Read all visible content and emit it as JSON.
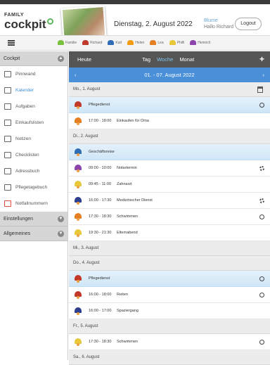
{
  "header": {
    "logo_top": "FAMILY",
    "logo_main": "cockpit",
    "date": "Dienstag, 2. August 2022",
    "user_name": "Blume",
    "user_greeting": "Hallo Richard",
    "logout": "Logout"
  },
  "family": [
    {
      "name": "Familie",
      "color": "#7bbf3f"
    },
    {
      "name": "Richard",
      "color": "#c0392b"
    },
    {
      "name": "Karl",
      "color": "#2f6db5"
    },
    {
      "name": "Helen",
      "color": "#f39c12"
    },
    {
      "name": "Lea",
      "color": "#e67e22"
    },
    {
      "name": "Philli",
      "color": "#e8c83a"
    },
    {
      "name": "Heinrich",
      "color": "#8e44ad"
    }
  ],
  "sidebar": {
    "section1": "Cockpit",
    "items": [
      {
        "label": "Pinnwand",
        "active": false
      },
      {
        "label": "Kalender",
        "active": true
      },
      {
        "label": "Aufgaben",
        "active": false
      },
      {
        "label": "Einkaufslisten",
        "active": false
      },
      {
        "label": "Notizen",
        "active": false
      },
      {
        "label": "Checklisten",
        "active": false
      },
      {
        "label": "Adressbuch",
        "active": false
      },
      {
        "label": "Pflegetagebuch",
        "active": false
      },
      {
        "label": "Notfallnummern",
        "active": false
      }
    ],
    "section2": "Einstellungen",
    "section3": "Allgemeines"
  },
  "calendar": {
    "today": "Heute",
    "tabs": [
      "Tag",
      "Woche",
      "Monat"
    ],
    "selected_tab": "Woche",
    "add": "+",
    "week_label": "01. - 07. August 2022",
    "prev": "‹",
    "next": "›",
    "days": [
      {
        "label": "Mo., 1. August",
        "birthday": true,
        "events": [
          {
            "allday": true,
            "title": "Pflegedienst",
            "color": "#c0392b",
            "indicator": "circle"
          },
          {
            "time": "17:00 - 18:00",
            "title": "Einkaufen für Oma",
            "color": "#e67e22",
            "indicator": ""
          }
        ]
      },
      {
        "label": "Di., 2. August",
        "birthday": false,
        "events": [
          {
            "allday": true,
            "title": "Geschäftsreise",
            "color": "#2f6db5",
            "indicator": ""
          },
          {
            "time": "09:00 - 10:00",
            "title": "Notartermin",
            "color": "#8e44ad",
            "indicator": "gear"
          },
          {
            "time": "09:45 - 11:00",
            "title": "Zahnarzt",
            "color": "#e8c83a",
            "indicator": ""
          },
          {
            "time": "16:00 - 17:30",
            "title": "Medizinischer Dienst",
            "color": "#2f3f8f",
            "indicator": "gear"
          },
          {
            "time": "17:30 - 18:30",
            "title": "Schwimmen",
            "color": "#e67e22",
            "indicator": "circle"
          },
          {
            "time": "19:30 - 21:30",
            "title": "Elternabend",
            "color": "#e8c83a",
            "indicator": ""
          }
        ]
      },
      {
        "label": "Mi., 3. August",
        "birthday": false,
        "events": []
      },
      {
        "label": "Do., 4. August",
        "birthday": false,
        "events": [
          {
            "allday": true,
            "title": "Pflegedienst",
            "color": "#c0392b",
            "indicator": "circle"
          },
          {
            "time": "16:00 - 18:00",
            "title": "Reiten",
            "color": "#c0392b",
            "indicator": "circle"
          },
          {
            "time": "16:00 - 17:00",
            "title": "Spaziergang",
            "color": "#2f3f8f",
            "indicator": ""
          }
        ]
      },
      {
        "label": "Fr., 5. August",
        "birthday": false,
        "events": [
          {
            "time": "17:30 - 18:30",
            "title": "Schwimmen",
            "color": "#e8c83a",
            "indicator": "circle"
          }
        ]
      },
      {
        "label": "Sa., 6. August",
        "birthday": false,
        "events": []
      }
    ]
  }
}
